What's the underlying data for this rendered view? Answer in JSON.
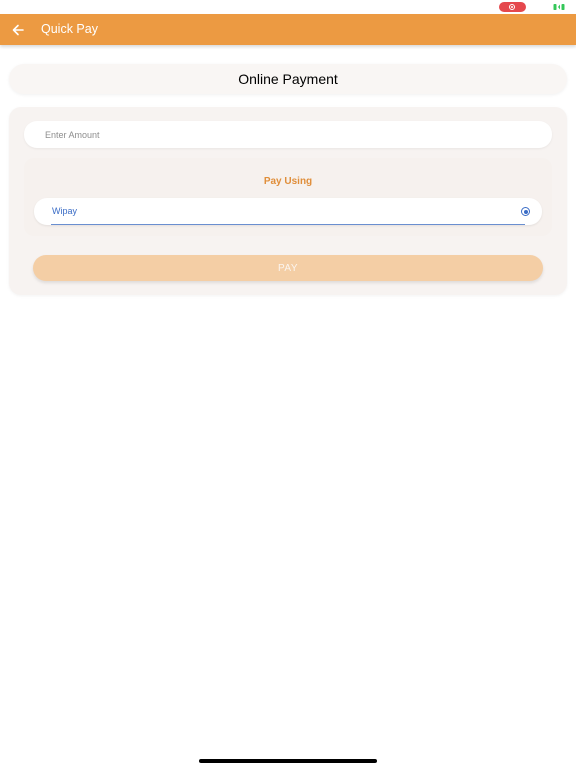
{
  "status_bar": {
    "icons": [
      "screen-record-icon",
      "battery-charging-icon"
    ],
    "record_color": "#e5484d",
    "battery_color": "#34c759"
  },
  "app_bar": {
    "title": "Quick Pay",
    "back_icon": "arrow-left-icon",
    "background": "#ec9a42"
  },
  "header": {
    "title": "Online Payment"
  },
  "form": {
    "amount_input": {
      "placeholder": "Enter Amount",
      "value": ""
    },
    "pay_using": {
      "label": "Pay Using",
      "methods": [
        {
          "label": "Wipay",
          "selected": true
        }
      ]
    },
    "pay_button": {
      "label": "PAY",
      "enabled": false
    }
  },
  "colors": {
    "accent": "#ec9a42",
    "pay_using": "#e08e3a",
    "radio": "#3a6cc6",
    "pay_button_disabled": "#f4cea5"
  }
}
